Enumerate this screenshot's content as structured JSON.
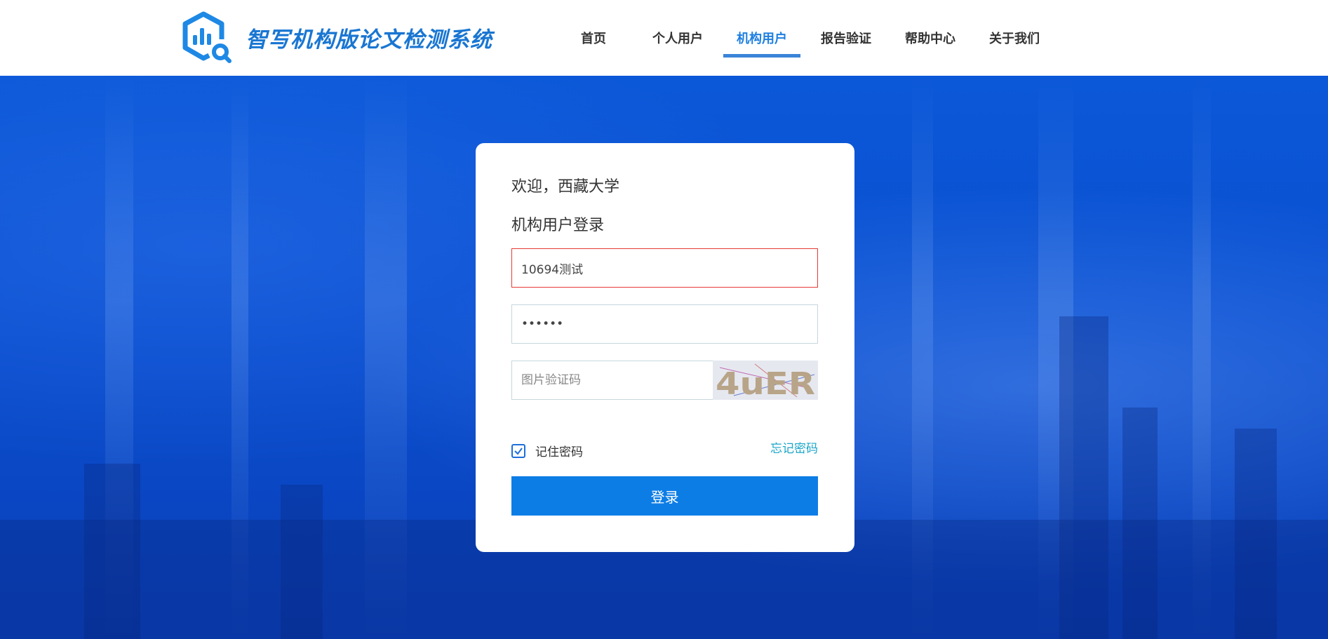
{
  "header": {
    "brand": "智写机构版论文检测系统",
    "nav": [
      {
        "label": "首页"
      },
      {
        "label": "个人用户"
      },
      {
        "label": "机构用户",
        "active": true
      },
      {
        "label": "报告验证"
      },
      {
        "label": "帮助中心"
      },
      {
        "label": "关于我们"
      }
    ]
  },
  "login": {
    "welcome": "欢迎，西藏大学",
    "title": "机构用户登录",
    "username_value": "10694测试",
    "password_value": "••••••",
    "captcha_placeholder": "图片验证码",
    "captcha_text": "4uER",
    "remember_label": "记住密码",
    "remember_checked": true,
    "forgot_label": "忘记密码",
    "submit_label": "登录"
  },
  "colors": {
    "brand": "#1976d2",
    "nav_active": "#1e7fe0",
    "button": "#0d7de6",
    "link": "#19a6c9",
    "error_border": "#e53935"
  },
  "icons": {
    "logo": "hexagon-chart-search-icon",
    "checkbox": "checkmark-icon"
  }
}
